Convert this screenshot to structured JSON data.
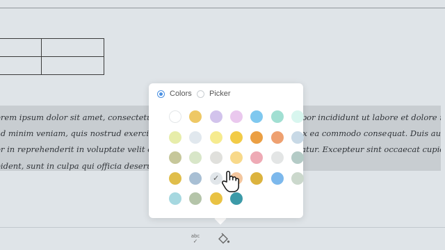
{
  "document": {
    "lines": [
      "orem ipsum dolor sit amet, consectetur adipiscing elit, sed do eiusmod tempor incididunt ut labore et dolore magna aliqua. Ut",
      "ad minim veniam, quis nostrud exercitation ullamco laboris nisi ut aliquip ex ea commodo consequat. Duis aute irure",
      "or in reprehenderit in voluptate velit esse cillum dolore eu fugiat nulla pariatur. Excepteur sint occaecat cupidatat non",
      "oident, sunt in culpa qui officia deserunt mollit anim id est laborum."
    ]
  },
  "color_popover": {
    "modes": [
      {
        "label": "Colors",
        "selected": true
      },
      {
        "label": "Picker",
        "selected": false
      }
    ],
    "swatch_rows": [
      [
        "#ffffff",
        "#eec865",
        "#d2c3ec",
        "#eac8ee",
        "#7fc8ef",
        "#a1dfd2",
        "#d8f6ef"
      ],
      [
        "#e7edaa",
        "#e1e8ee",
        "#f6eb8f",
        "#f2cb47",
        "#eb9f43",
        "#eea070",
        "#c8d9e6"
      ],
      [
        "#c6c79a",
        "#d8e6c8",
        "#e0e0dc",
        "#f8d98a",
        "#eeaab5",
        "#e3e5e5",
        "#b4cbc6"
      ],
      [
        "#e0be4b",
        "#a8bfd4",
        "#e1e6ea",
        "#f3c69e",
        "#dcb33e",
        "#7cb8ec",
        "#cbd8cc"
      ],
      [
        "#a6d8e0",
        "#b4c4a9",
        "#e9c243",
        "#3c9aa8"
      ]
    ],
    "selected_swatch": "#e1e6ea"
  },
  "toolbar": {
    "spellcheck_icon": "spellcheck-icon",
    "spellcheck_text": "abc",
    "fill_icon": "paint-bucket-icon"
  }
}
